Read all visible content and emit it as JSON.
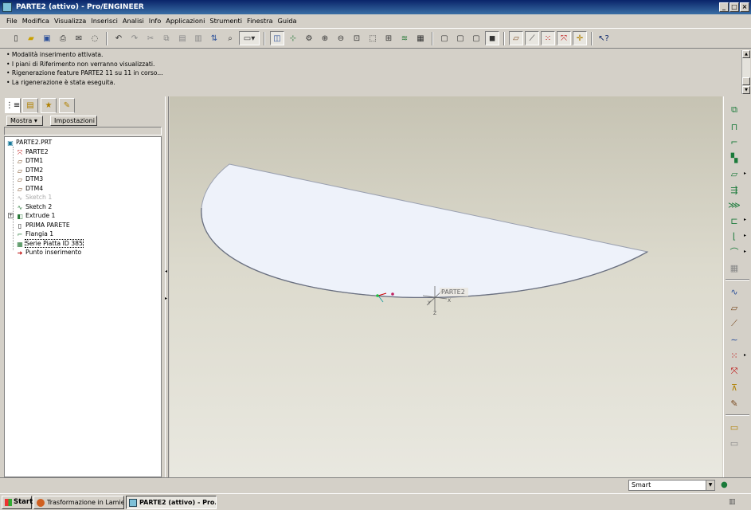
{
  "window": {
    "title": "PARTE2 (attivo) - Pro/ENGINEER"
  },
  "menu": [
    "File",
    "Modifica",
    "Visualizza",
    "Inserisci",
    "Analisi",
    "Info",
    "Applicazioni",
    "Strumenti",
    "Finestra",
    "Guida"
  ],
  "messages": [
    "Modalità inserimento attivata.",
    "I piani di Riferimento non verranno visualizzati.",
    "Rigenerazione feature PARTE2 11 su 11 in corso...",
    "La rigenerazione è stata eseguita."
  ],
  "panel": {
    "show_label": "Mostra",
    "settings_label": "Impostazioni"
  },
  "tree": {
    "root": "PARTE2.PRT",
    "items": [
      {
        "label": "PARTE2",
        "icon": "csys-icon"
      },
      {
        "label": "DTM1",
        "icon": "datum-plane-icon"
      },
      {
        "label": "DTM2",
        "icon": "datum-plane-icon"
      },
      {
        "label": "DTM3",
        "icon": "datum-plane-icon"
      },
      {
        "label": "DTM4",
        "icon": "datum-plane-icon"
      },
      {
        "label": "Sketch 1",
        "icon": "sketch-icon",
        "dim": true
      },
      {
        "label": "Sketch 2",
        "icon": "sketch-icon"
      },
      {
        "label": "Extrude 1",
        "icon": "extrude-icon"
      },
      {
        "label": "PRIMA PARETE",
        "icon": "wall-icon"
      },
      {
        "label": "Flangia 1",
        "icon": "flange-icon"
      },
      {
        "label": "Serie Piatta ID 385",
        "icon": "flat-wall-icon",
        "selected": true
      },
      {
        "label": "Punto inserimento",
        "icon": "insert-arrow-icon"
      }
    ]
  },
  "viewport": {
    "csys_label": "PARTE2",
    "axes": [
      "X",
      "Y",
      "Z"
    ],
    "part_fill": "#eef2fa"
  },
  "status": {
    "filter_value": "Smart"
  },
  "taskbar": {
    "start_label": "Start",
    "tasks": [
      "Trasformazione in Lamier...",
      "PARTE2 (attivo) - Pro..."
    ]
  }
}
